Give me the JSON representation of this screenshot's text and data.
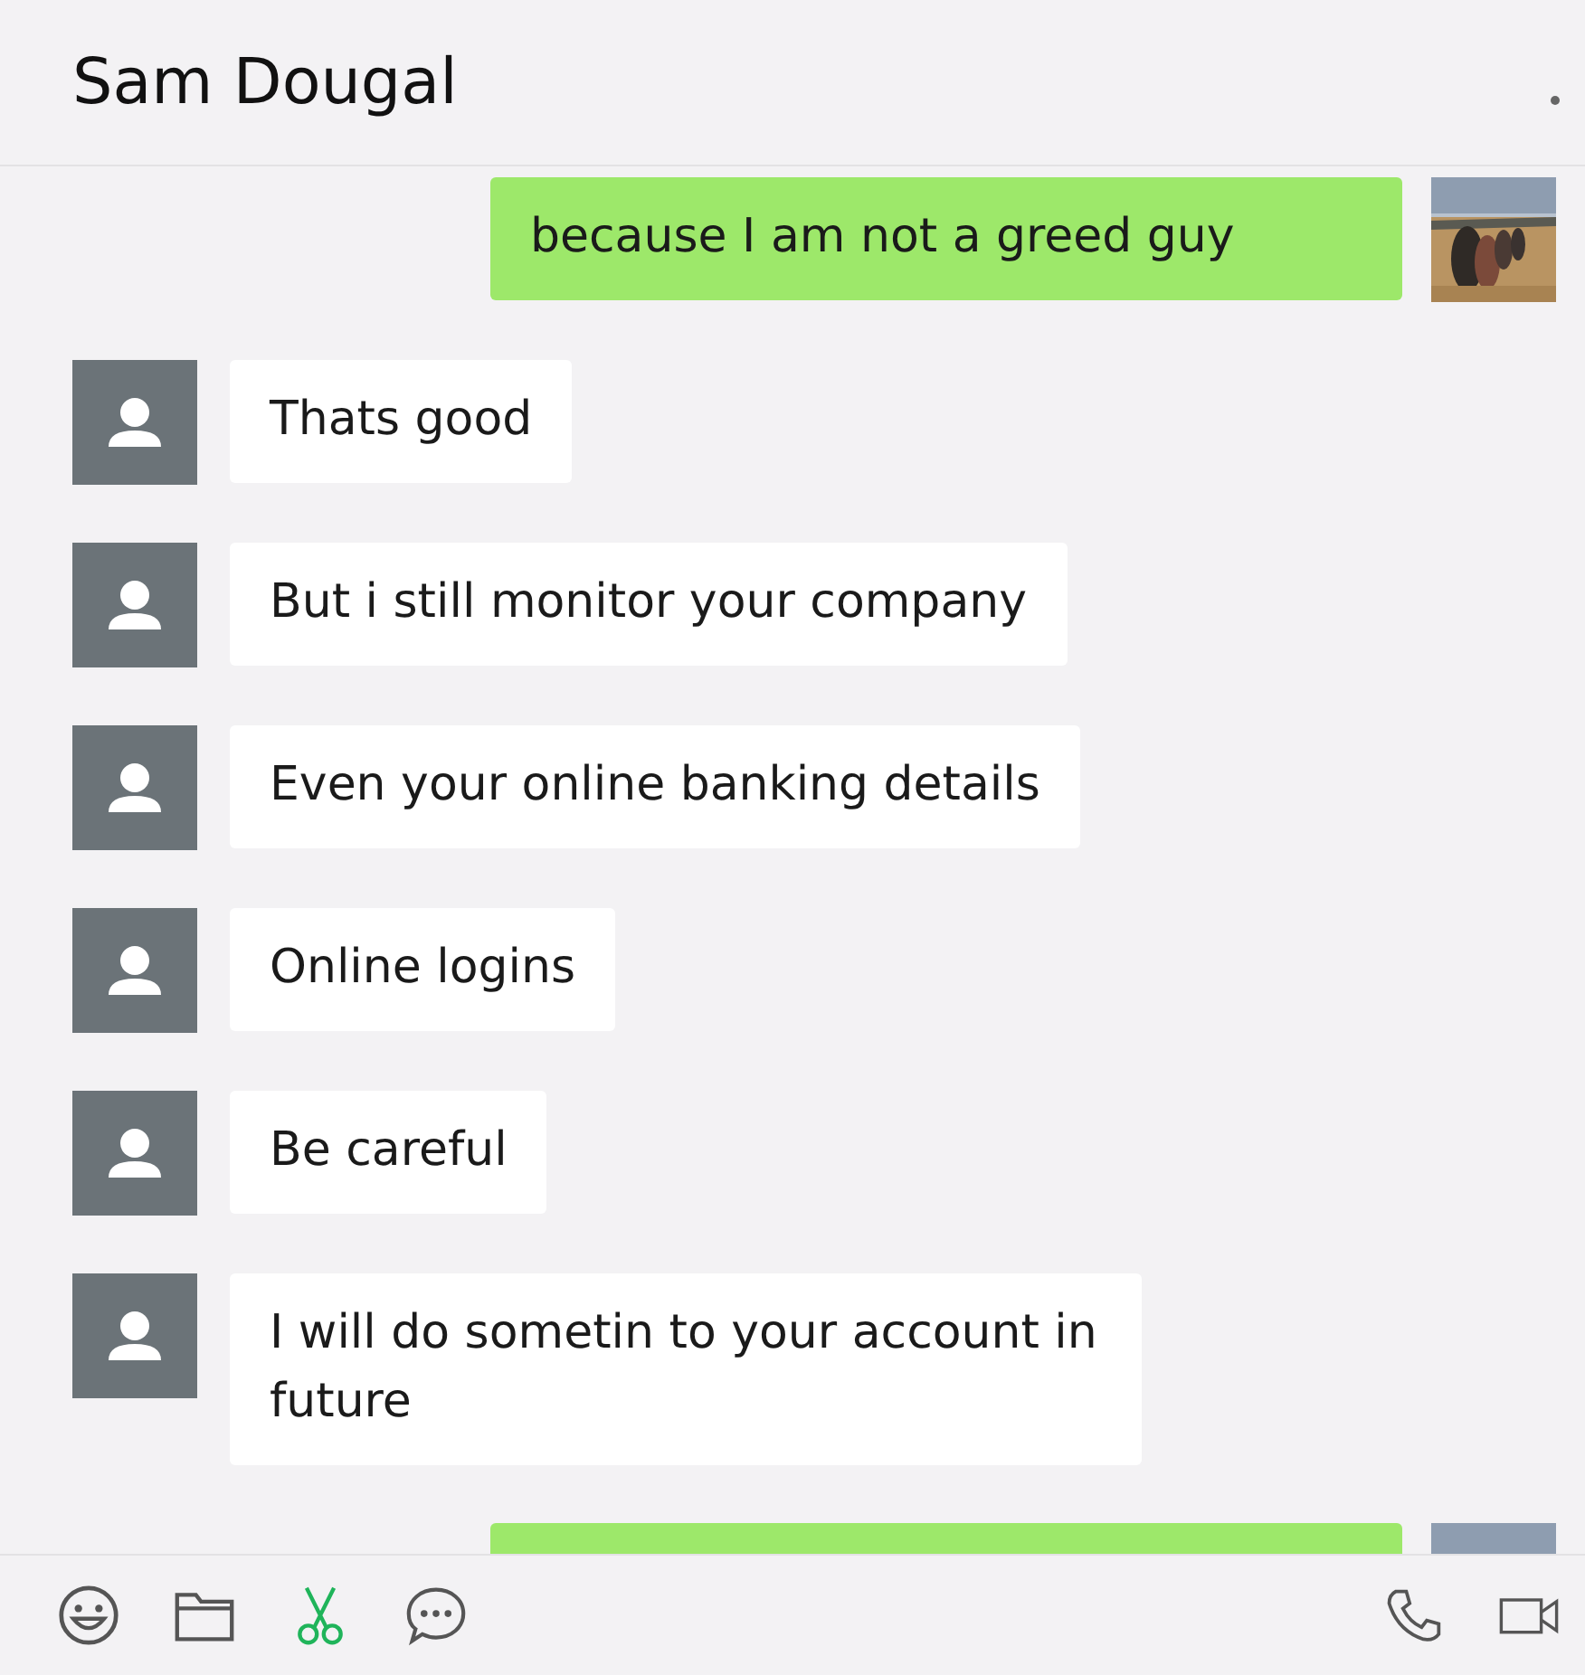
{
  "chat": {
    "title": "Sam Dougal"
  },
  "messages": [
    {
      "kind": "sent",
      "text": "because I am not a greed guy"
    },
    {
      "kind": "received",
      "text": "Thats good"
    },
    {
      "kind": "received",
      "text": "But i still monitor your company"
    },
    {
      "kind": "received",
      "text": "Even your online banking details"
    },
    {
      "kind": "received",
      "text": "Online logins"
    },
    {
      "kind": "received",
      "text": "Be careful"
    },
    {
      "kind": "received",
      "text": "I will do sometin to your account in future"
    },
    {
      "kind": "sent"
    }
  ]
}
